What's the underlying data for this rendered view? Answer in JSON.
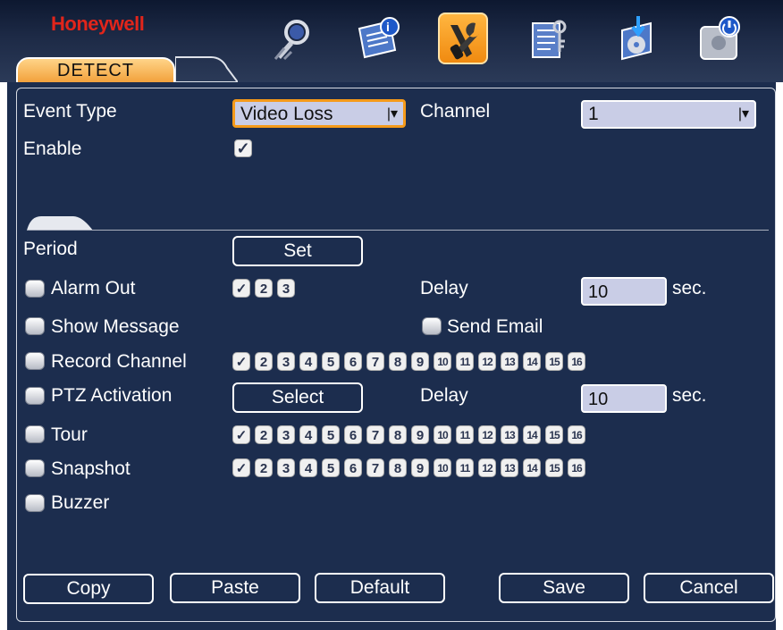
{
  "app": {
    "brand": "Honeywell",
    "active_tab": "DETECT"
  },
  "toolbar": {
    "icons": [
      {
        "name": "search-icon",
        "active": false
      },
      {
        "name": "info-icon",
        "active": false
      },
      {
        "name": "setting-tools-icon",
        "active": true
      },
      {
        "name": "advanced-icon",
        "active": false
      },
      {
        "name": "backup-icon",
        "active": false
      },
      {
        "name": "shutdown-icon",
        "active": false
      }
    ]
  },
  "form": {
    "event_type_label": "Event Type",
    "event_type_value": "Video Loss",
    "channel_label": "Channel",
    "channel_value": "1",
    "enable_label": "Enable",
    "enable_checked": true,
    "period_label": "Period",
    "set_button": "Set",
    "alarm_out_label": "Alarm Out",
    "alarm_out_channels": [
      "✓",
      "2",
      "3"
    ],
    "delay_label": "Delay",
    "delay_value": "10",
    "sec_label": "sec.",
    "show_message_label": "Show Message",
    "send_email_label": "Send Email",
    "record_channel_label": "Record Channel",
    "ptz_activation_label": "PTZ Activation",
    "select_button": "Select",
    "ptz_delay_label": "Delay",
    "ptz_delay_value": "10",
    "ptz_sec_label": "sec.",
    "tour_label": "Tour",
    "snapshot_label": "Snapshot",
    "buzzer_label": "Buzzer",
    "channel_chips": [
      "✓",
      "2",
      "3",
      "4",
      "5",
      "6",
      "7",
      "8",
      "9",
      "10",
      "11",
      "12",
      "13",
      "14",
      "15",
      "16"
    ]
  },
  "buttons": {
    "copy": "Copy",
    "paste": "Paste",
    "default": "Default",
    "save": "Save",
    "cancel": "Cancel"
  }
}
